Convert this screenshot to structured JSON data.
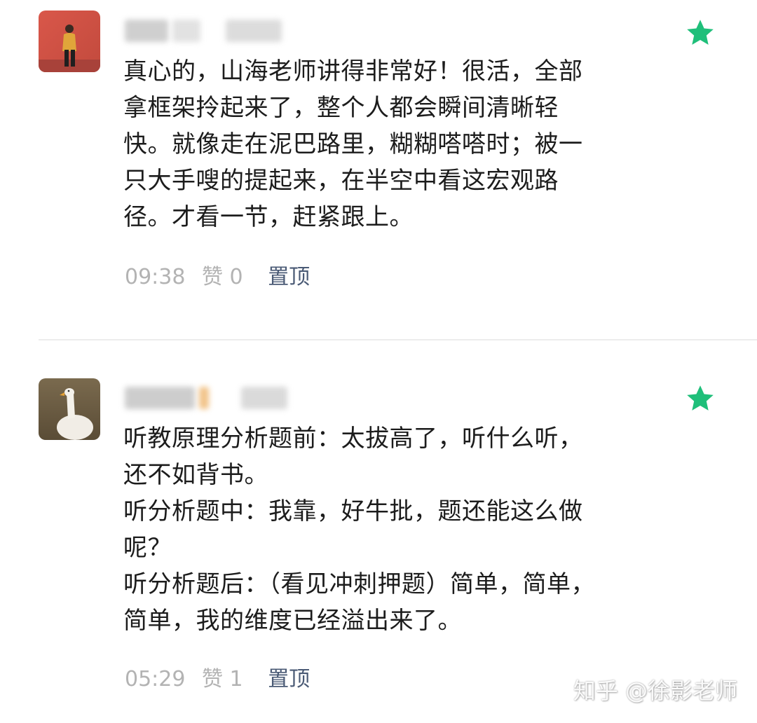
{
  "colors": {
    "star": "#1fbf7a",
    "pin_link": "#4a5a75",
    "meta_gray": "#b3b3b3",
    "text": "#1c1c1c"
  },
  "comments": [
    {
      "avatar_icon": "person-photo-avatar",
      "lines": [
        "真心的，山海老师讲得非常好！很活，全部",
        "拿框架拎起来了，整个人都会瞬间清晰轻",
        "快。就像走在泥巴路里，糊糊嗒嗒时；被一",
        "只大手嗖的提起来，在半空中看这宏观路",
        "径。才看一节，赶紧跟上。"
      ],
      "time": "09:38",
      "likes": "赞 0",
      "pin_label": "置顶",
      "starred_icon": "star-icon"
    },
    {
      "avatar_icon": "goose-photo-avatar",
      "lines": [
        "听教原理分析题前：太拔高了，听什么听，",
        "还不如背书。",
        "听分析题中：我靠，好牛批，题还能这么做",
        "呢？",
        "听分析题后：（看见冲刺押题）简单，简单，",
        "简单，我的维度已经溢出来了。"
      ],
      "time": "05:29",
      "likes": "赞 1",
      "pin_label": "置顶",
      "starred_icon": "star-icon"
    }
  ],
  "watermark": "知乎 @徐影老师"
}
